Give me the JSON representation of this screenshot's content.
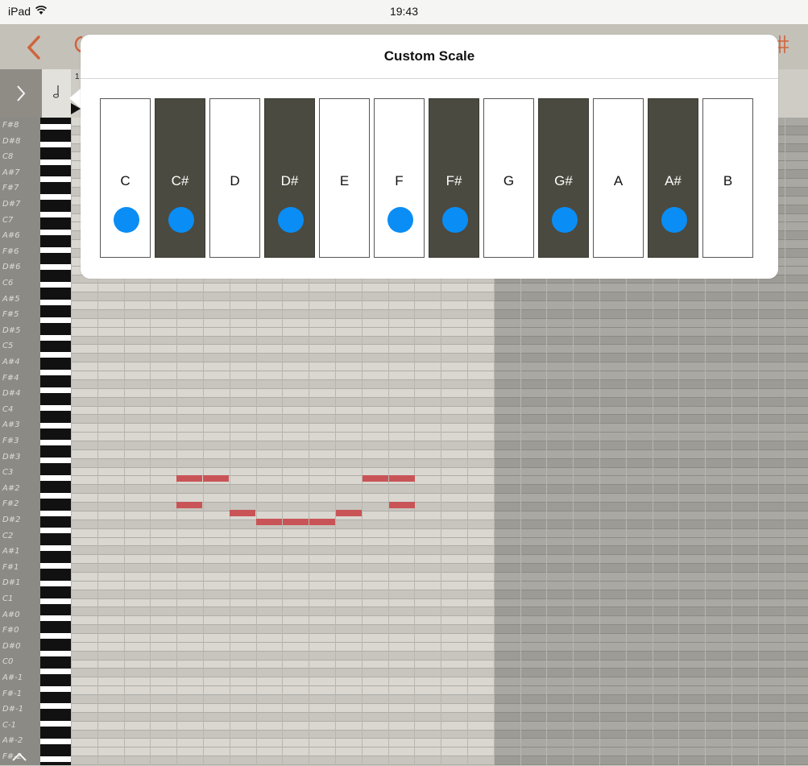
{
  "status_bar": {
    "device": "iPad",
    "time": "19:43"
  },
  "colors": {
    "accent": "#d0633c",
    "selected_dot": "#0a8df5",
    "note": "#c95457"
  },
  "popover": {
    "title": "Custom Scale",
    "keys": [
      {
        "label": "C",
        "color": "white",
        "selected": true
      },
      {
        "label": "C#",
        "color": "black",
        "selected": true
      },
      {
        "label": "D",
        "color": "white",
        "selected": false
      },
      {
        "label": "D#",
        "color": "black",
        "selected": true
      },
      {
        "label": "E",
        "color": "white",
        "selected": false
      },
      {
        "label": "F",
        "color": "white",
        "selected": true
      },
      {
        "label": "F#",
        "color": "black",
        "selected": true
      },
      {
        "label": "G",
        "color": "white",
        "selected": false
      },
      {
        "label": "G#",
        "color": "black",
        "selected": true
      },
      {
        "label": "A",
        "color": "white",
        "selected": false
      },
      {
        "label": "A#",
        "color": "black",
        "selected": true
      },
      {
        "label": "B",
        "color": "white",
        "selected": false
      }
    ]
  },
  "piano_roll": {
    "measure_number": "1",
    "note_labels": [
      "F#8",
      "D#8",
      "C8",
      "A#7",
      "F#7",
      "D#7",
      "C7",
      "A#6",
      "F#6",
      "D#6",
      "C6",
      "A#5",
      "F#5",
      "D#5",
      "C5",
      "A#4",
      "F#4",
      "D#4",
      "C4",
      "A#3",
      "F#3",
      "D#3",
      "C3",
      "A#2",
      "F#2",
      "D#2",
      "C2",
      "A#1",
      "F#1",
      "D#1",
      "C1",
      "A#0",
      "F#0",
      "D#0",
      "C0",
      "A#-1",
      "F#-1",
      "D#-1",
      "C-1",
      "A#-2",
      "F#-2"
    ]
  }
}
